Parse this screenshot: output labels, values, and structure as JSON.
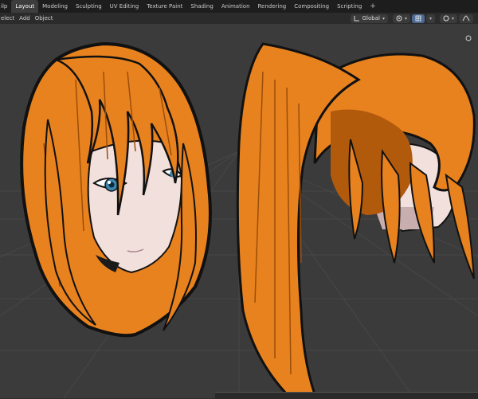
{
  "menu_stub": "ilp",
  "workspace_tabs": [
    {
      "label": "Layout",
      "active": true
    },
    {
      "label": "Modeling",
      "active": false
    },
    {
      "label": "Sculpting",
      "active": false
    },
    {
      "label": "UV Editing",
      "active": false
    },
    {
      "label": "Texture Paint",
      "active": false
    },
    {
      "label": "Shading",
      "active": false
    },
    {
      "label": "Animation",
      "active": false
    },
    {
      "label": "Rendering",
      "active": false
    },
    {
      "label": "Compositing",
      "active": false
    },
    {
      "label": "Scripting",
      "active": false
    }
  ],
  "add_workspace": "+",
  "header": {
    "select_label": "elect",
    "add_label": "Add",
    "object_label": "Object",
    "transform_orientation": "Global"
  },
  "colors": {
    "hair": "#e8821e",
    "hair_shadow": "#b25a0c",
    "outline": "#111111",
    "skin": "#f2e0dc",
    "skin_shadow": "#c9aeb0",
    "grid": "#464646",
    "accent": "#4d6a94"
  },
  "icons": [
    "transform-orientation-icon",
    "pivot-icon",
    "snap-icon",
    "proportional-edit-icon",
    "falloff-icon",
    "view-gizmo-icon"
  ]
}
